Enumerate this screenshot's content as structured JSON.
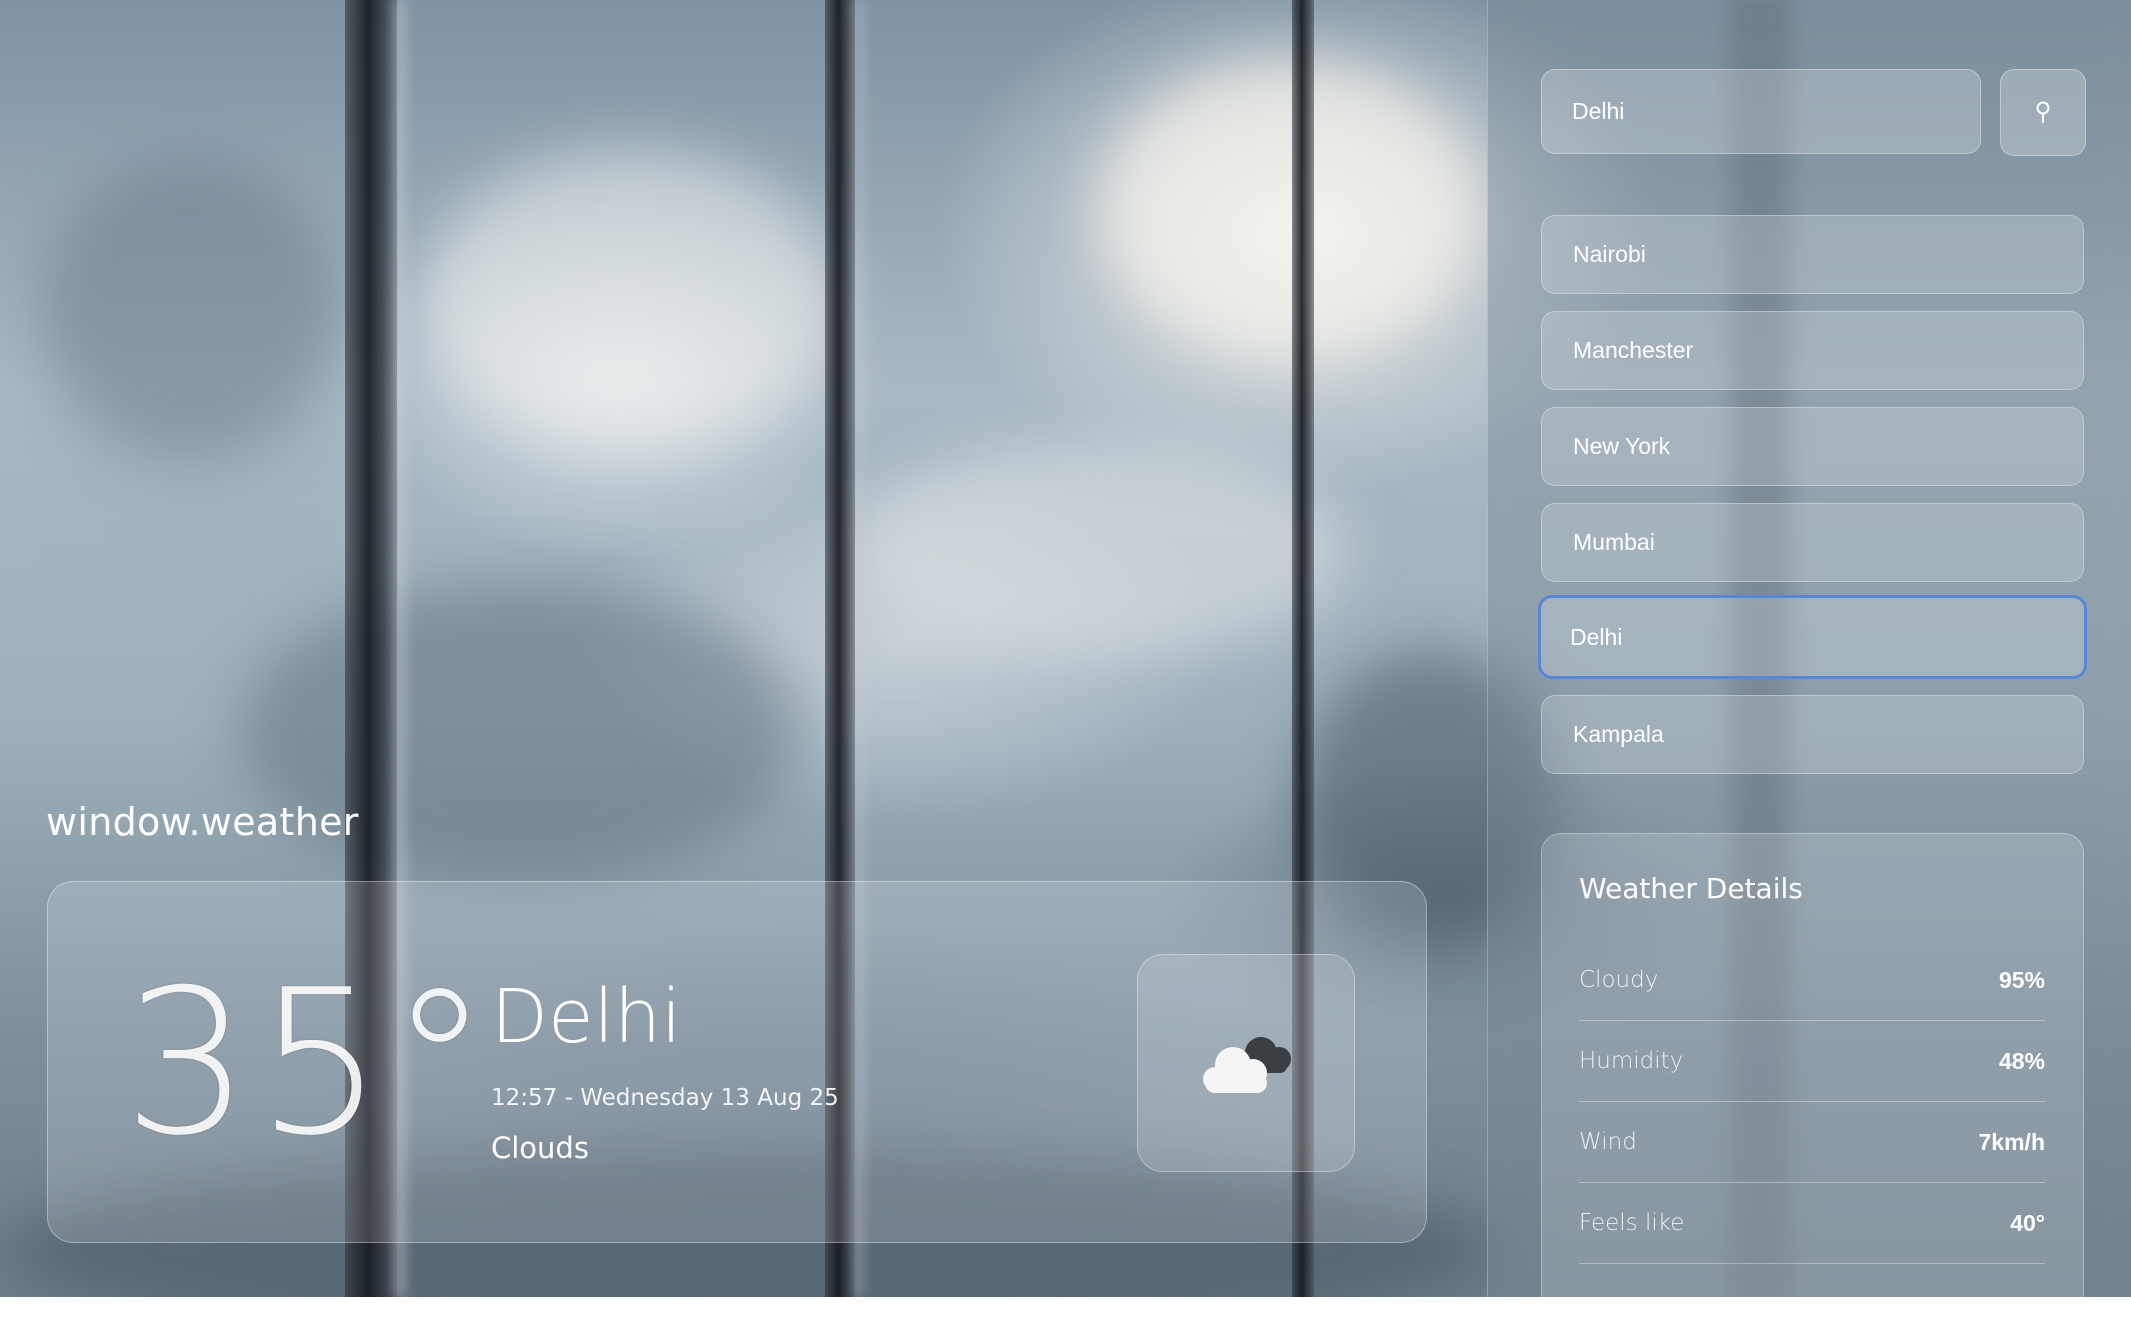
{
  "app": {
    "brand": "window.weather"
  },
  "search": {
    "value": "Delhi",
    "button_icon": "search-pin-icon"
  },
  "cities": [
    {
      "label": "Nairobi",
      "selected": false
    },
    {
      "label": "Manchester",
      "selected": false
    },
    {
      "label": "New York",
      "selected": false
    },
    {
      "label": "Mumbai",
      "selected": false
    },
    {
      "label": "Delhi",
      "selected": true
    },
    {
      "label": "Kampala",
      "selected": false
    }
  ],
  "current": {
    "temperature": "35°",
    "city": "Delhi",
    "datetime": "12:57 - Wednesday 13 Aug 25",
    "condition": "Clouds",
    "icon": "cloud-icon"
  },
  "details": {
    "title": "Weather Details",
    "rows": [
      {
        "label": "Cloudy",
        "value": "95%"
      },
      {
        "label": "Humidity",
        "value": "48%"
      },
      {
        "label": "Wind",
        "value": "7km/h"
      },
      {
        "label": "Feels like",
        "value": "40°"
      }
    ]
  },
  "colors": {
    "selected_border": "#5b86d6",
    "text": "#ffffff"
  }
}
